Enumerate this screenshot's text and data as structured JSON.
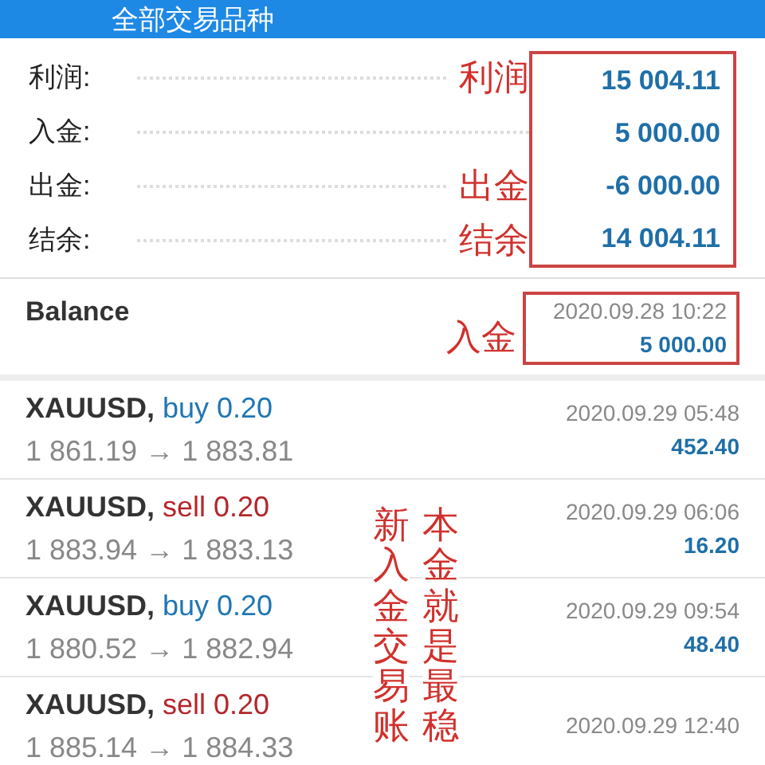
{
  "header": {
    "title": "全部交易品种"
  },
  "summary": {
    "rows": [
      {
        "label": "利润:",
        "note": "利润",
        "value": "15 004.11"
      },
      {
        "label": "入金:",
        "value": "5 000.00"
      },
      {
        "label": "出金:",
        "note": "出金",
        "value": "-6 000.00"
      },
      {
        "label": "结余:",
        "note": "结余",
        "value": "14 004.11"
      }
    ]
  },
  "balance": {
    "title": "Balance",
    "date": "2020.09.28 10:22",
    "amount": "5 000.00",
    "note": "入金"
  },
  "trades": [
    {
      "symbol": "XAUUSD,",
      "kind": "buy",
      "order": "buy 0.20",
      "prices": "1 861.19 → 1 883.81",
      "date": "2020.09.29 05:48",
      "profit": "452.40"
    },
    {
      "symbol": "XAUUSD,",
      "kind": "sell",
      "order": "sell 0.20",
      "prices": "1 883.94 → 1 883.13",
      "date": "2020.09.29 06:06",
      "profit": "16.20"
    },
    {
      "symbol": "XAUUSD,",
      "kind": "buy",
      "order": "buy 0.20",
      "prices": "1 880.52 → 1 882.94",
      "date": "2020.09.29 09:54",
      "profit": "48.40"
    },
    {
      "symbol": "XAUUSD,",
      "kind": "sell",
      "order": "sell 0.20",
      "prices": "1 885.14 → 1 884.33",
      "date": "2020.09.29 12:40"
    }
  ],
  "vertical_notes": [
    "新入金交易账",
    "本金就是最稳"
  ]
}
